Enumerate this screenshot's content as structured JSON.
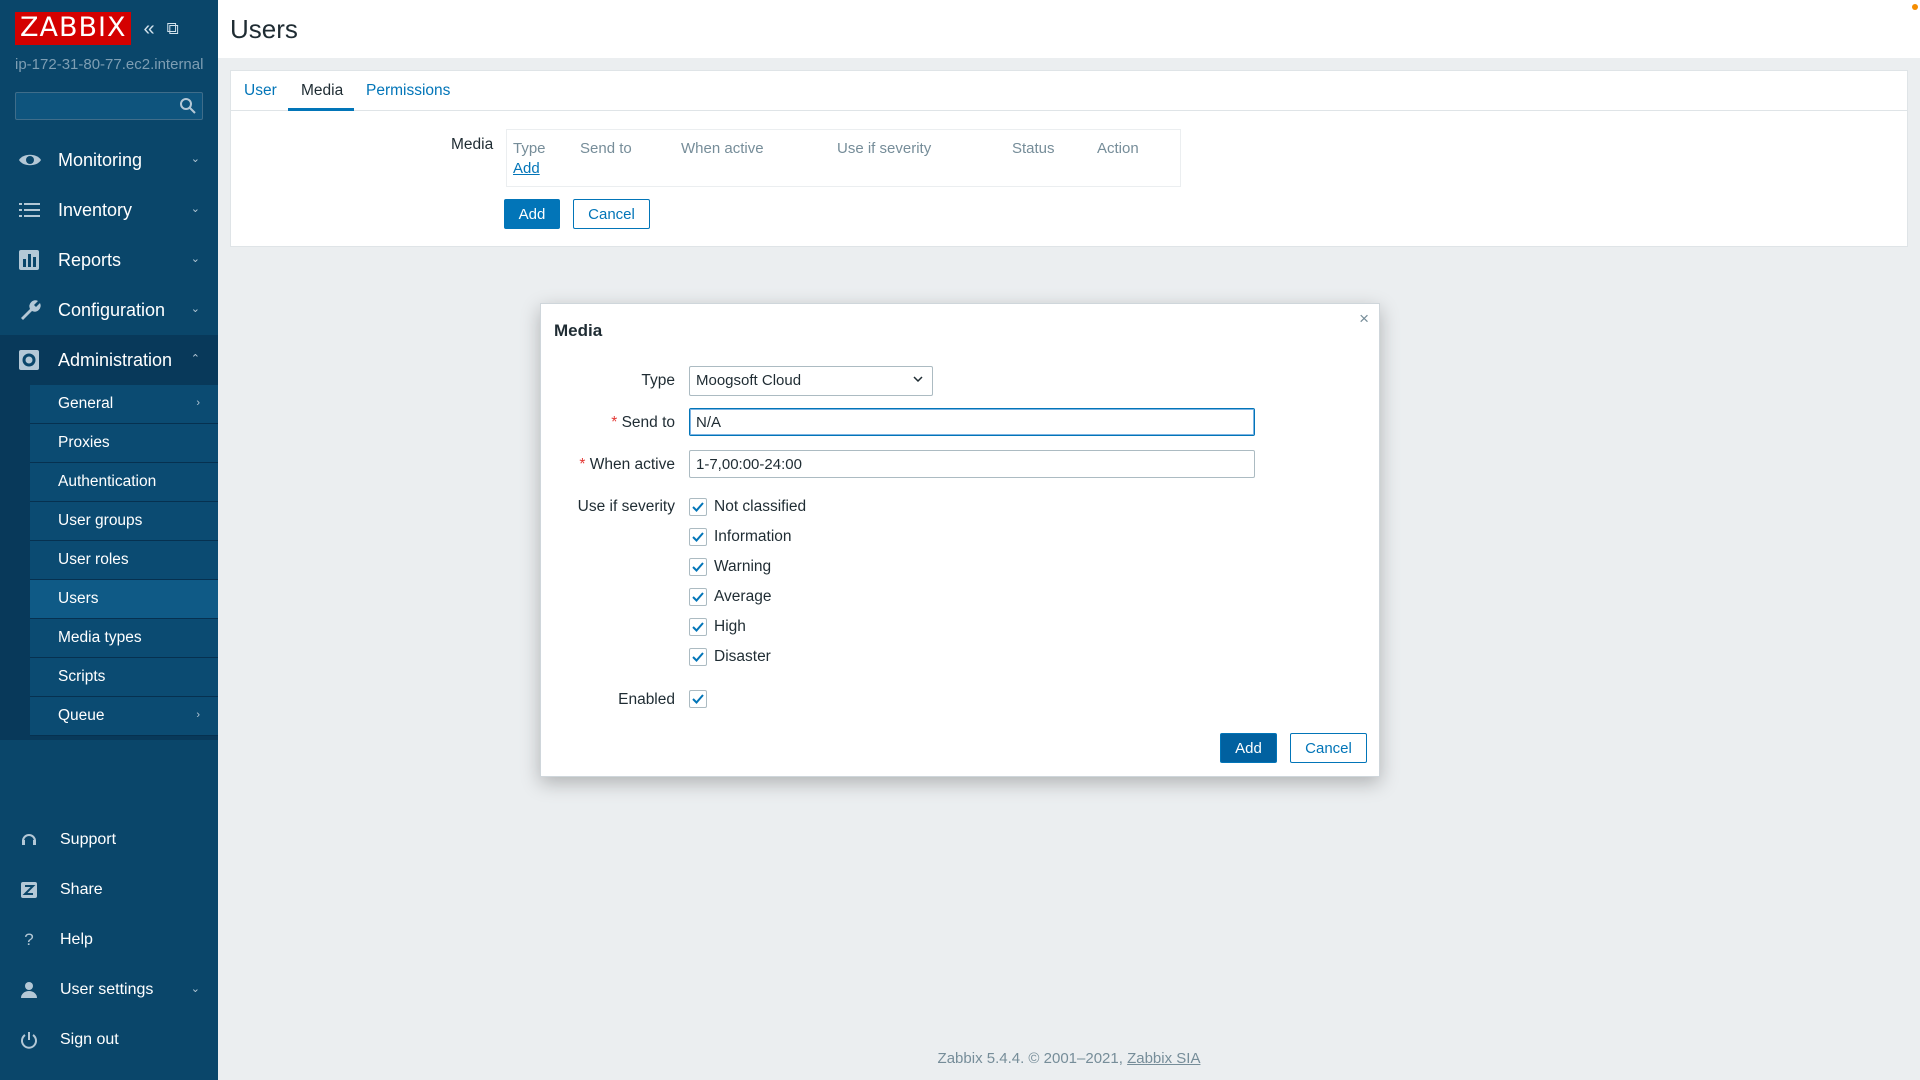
{
  "brand": {
    "logo": "ZABBIX",
    "server": "ip-172-31-80-77.ec2.internal"
  },
  "sidebar": {
    "menu": [
      {
        "label": "Monitoring",
        "icon": "eye-icon"
      },
      {
        "label": "Inventory",
        "icon": "list-icon"
      },
      {
        "label": "Reports",
        "icon": "bar-chart-icon"
      },
      {
        "label": "Configuration",
        "icon": "wrench-icon"
      },
      {
        "label": "Administration",
        "icon": "gear-icon"
      }
    ],
    "admin_submenu": [
      {
        "label": "General"
      },
      {
        "label": "Proxies"
      },
      {
        "label": "Authentication"
      },
      {
        "label": "User groups"
      },
      {
        "label": "User roles"
      },
      {
        "label": "Users"
      },
      {
        "label": "Media types"
      },
      {
        "label": "Scripts"
      },
      {
        "label": "Queue"
      }
    ],
    "bottom": [
      {
        "label": "Support",
        "icon": "headset-icon"
      },
      {
        "label": "Share",
        "icon": "share-icon"
      },
      {
        "label": "Help",
        "icon": "question-icon"
      },
      {
        "label": "User settings",
        "icon": "user-icon"
      },
      {
        "label": "Sign out",
        "icon": "power-icon"
      }
    ]
  },
  "page": {
    "title": "Users"
  },
  "tabs": [
    {
      "label": "User"
    },
    {
      "label": "Media"
    },
    {
      "label": "Permissions"
    }
  ],
  "media_section": {
    "label": "Media",
    "columns": [
      "Type",
      "Send to",
      "When active",
      "Use if severity",
      "Status",
      "Action"
    ],
    "add_link": "Add",
    "add_button": "Add",
    "cancel_button": "Cancel"
  },
  "modal": {
    "title": "Media",
    "close": "×",
    "type_label": "Type",
    "type_value": "Moogsoft Cloud",
    "send_to_label": "Send to",
    "send_to_value": "N/A",
    "when_active_label": "When active",
    "when_active_value": "1-7,00:00-24:00",
    "severity_label": "Use if severity",
    "severities": [
      {
        "label": "Not classified",
        "checked": true
      },
      {
        "label": "Information",
        "checked": true
      },
      {
        "label": "Warning",
        "checked": true
      },
      {
        "label": "Average",
        "checked": true
      },
      {
        "label": "High",
        "checked": true
      },
      {
        "label": "Disaster",
        "checked": true
      }
    ],
    "enabled_label": "Enabled",
    "add_button": "Add",
    "cancel_button": "Cancel",
    "required_mark": "*"
  },
  "footer": {
    "text": "Zabbix 5.4.4. © 2001–2021,",
    "link": "Zabbix SIA"
  },
  "colors": {
    "sidebar": "#0a466a",
    "accent": "#0275b8",
    "logo": "#d40000"
  }
}
